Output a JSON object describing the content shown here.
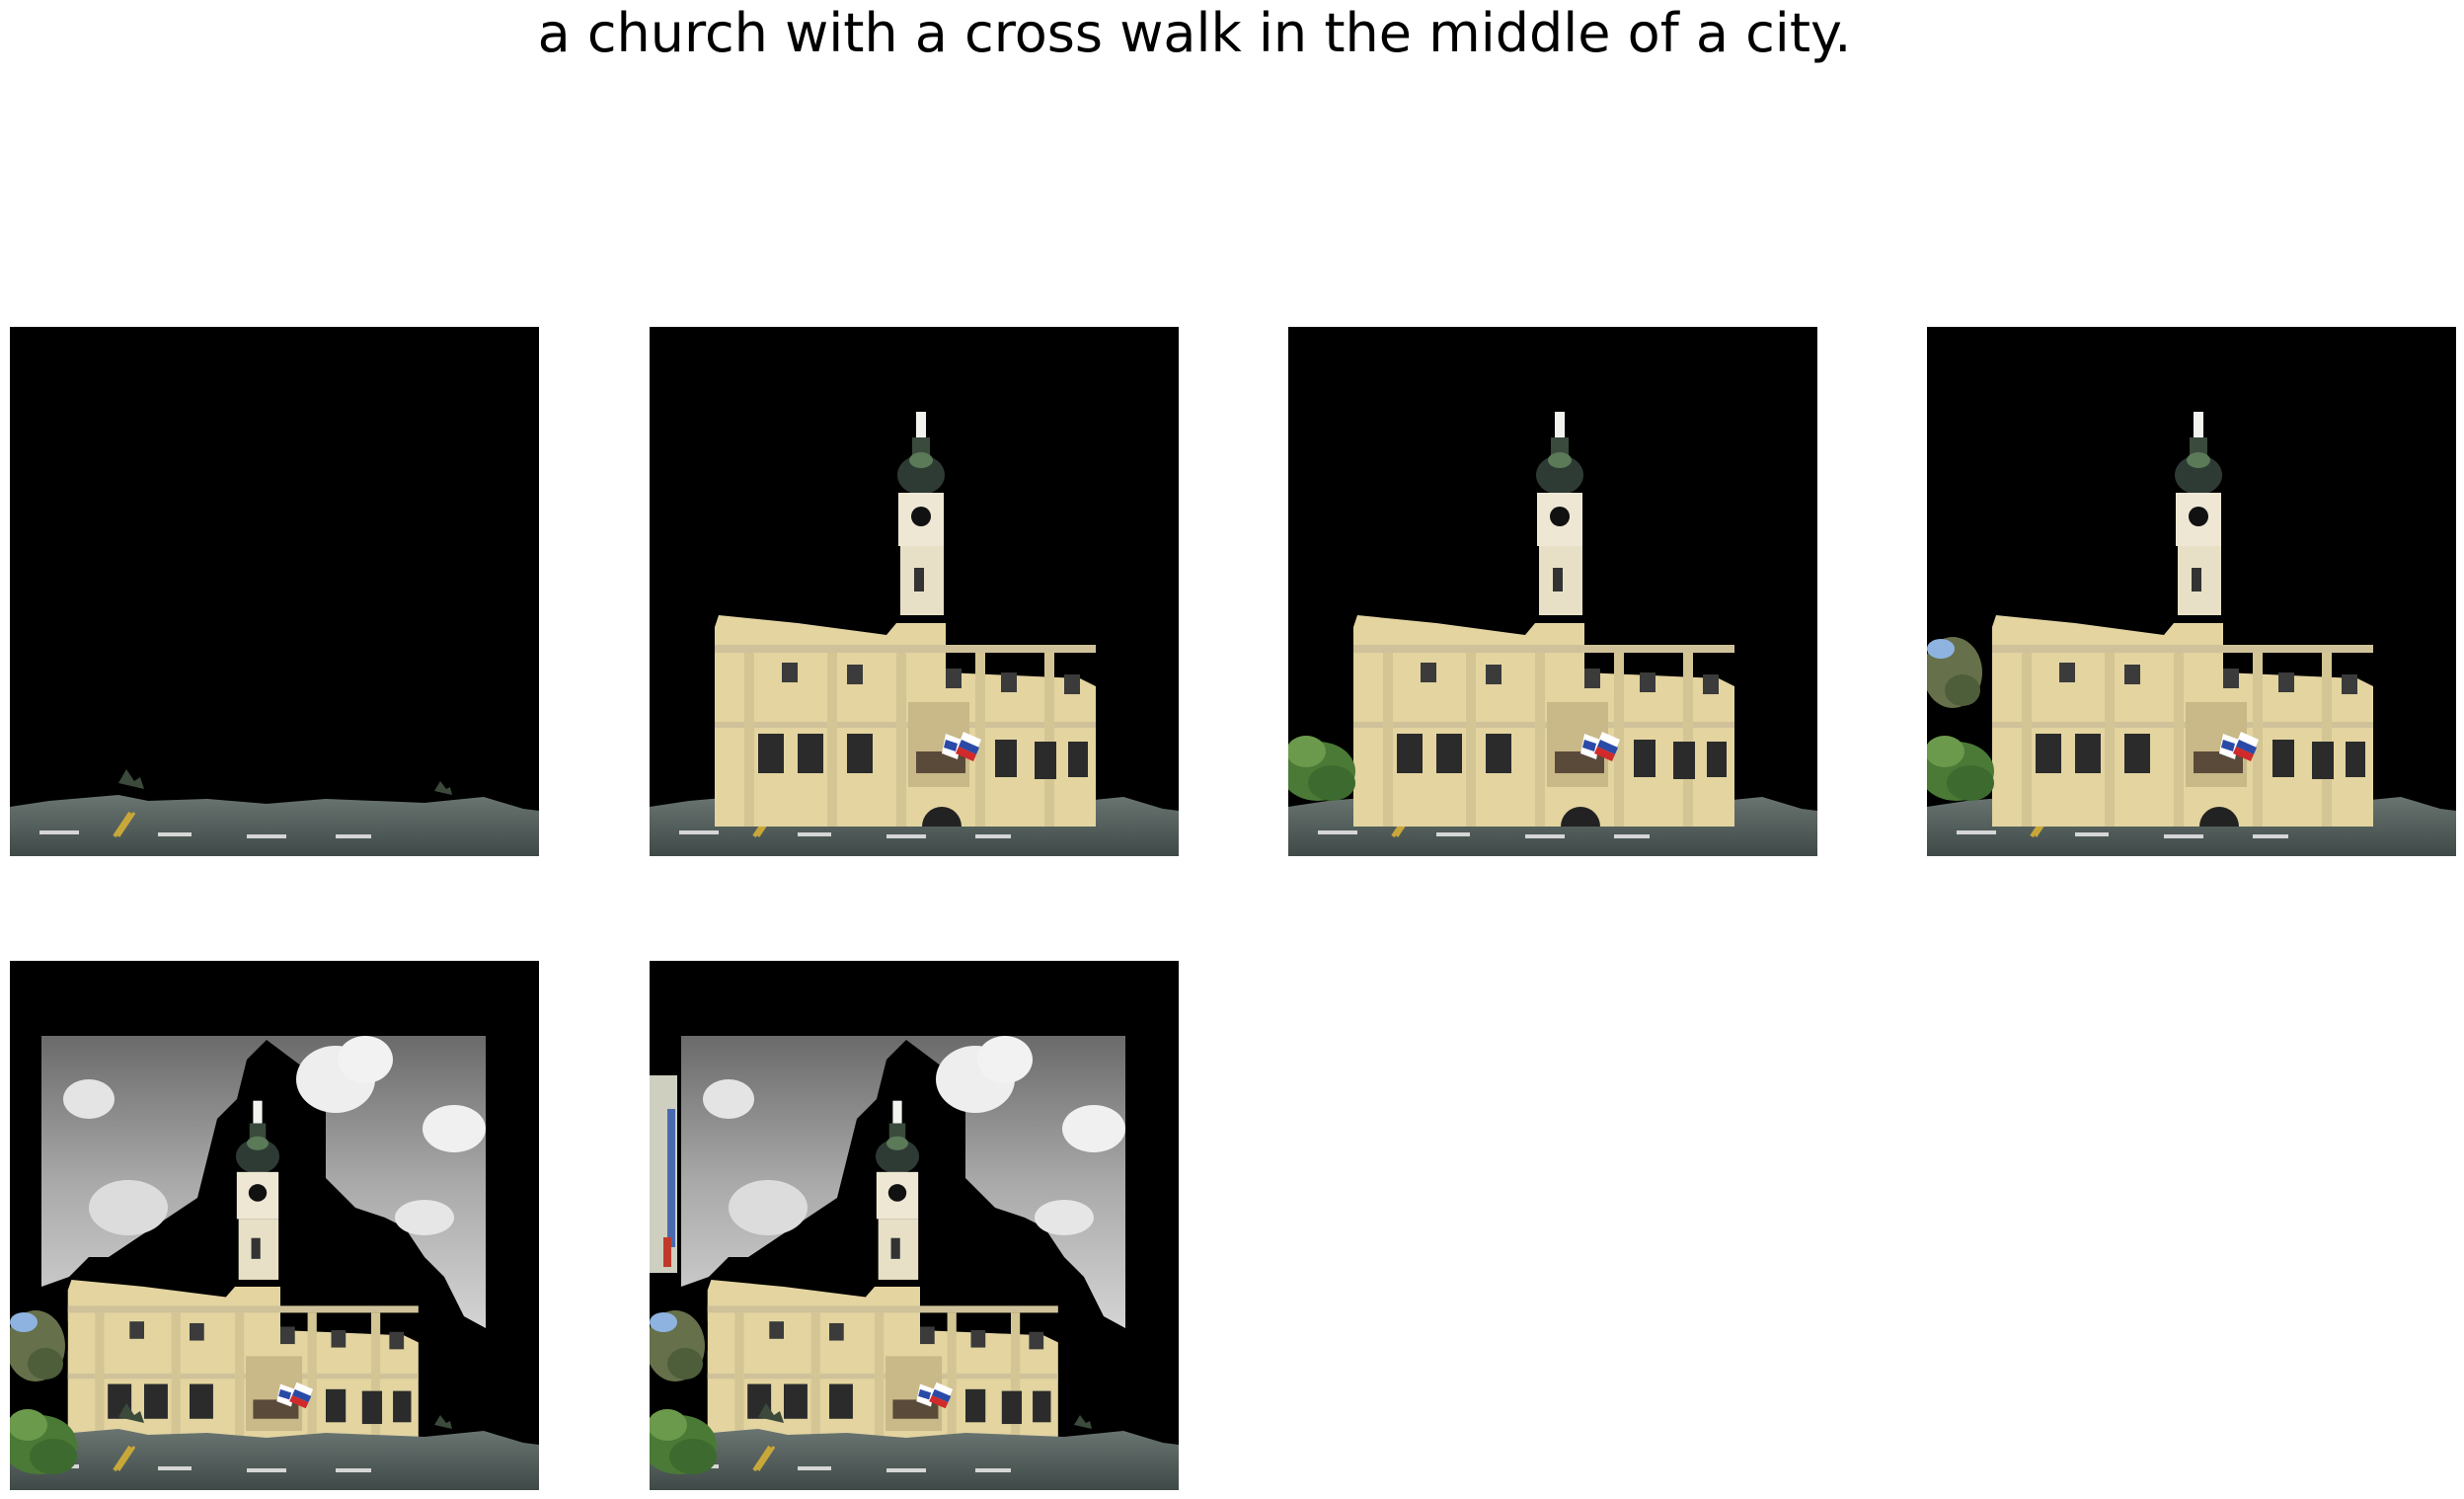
{
  "caption": "a church with a cross walk in the middle of a city.",
  "panels": [
    {
      "name": "stage-1",
      "content": "road-only"
    },
    {
      "name": "stage-2",
      "content": "road-building"
    },
    {
      "name": "stage-3",
      "content": "road-building-tree-bottom"
    },
    {
      "name": "stage-4",
      "content": "road-building-trees"
    },
    {
      "name": "stage-5",
      "content": "road-building-trees-sky"
    },
    {
      "name": "stage-6",
      "content": "road-building-trees-sky-leftstrip"
    }
  ],
  "colors": {
    "background": "#000000",
    "road": "#4e5a58",
    "facade": "#e6d8a4",
    "tower": "#f0ebdc",
    "roof": "#2e3b34",
    "tree": "#4f7f3a",
    "sky": "#b9b9b9"
  }
}
